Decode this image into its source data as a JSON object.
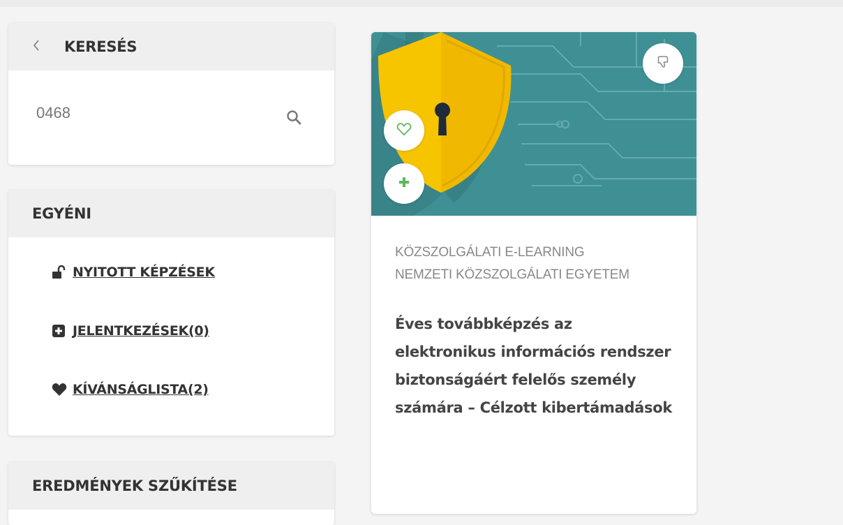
{
  "search_panel": {
    "title": "KERESÉS",
    "search_value": "0468",
    "icons": {
      "back": "chevron-left-icon",
      "search": "search-icon"
    }
  },
  "personal_panel": {
    "title": "EGYÉNI",
    "links": [
      {
        "label": "NYITOTT KÉPZÉSEK",
        "icon": "unlock-icon"
      },
      {
        "label": "JELENTKEZÉSEK(0)",
        "icon": "plus-square-icon"
      },
      {
        "label": "KÍVÁNSÁGLISTA(2)",
        "icon": "heart-icon"
      }
    ]
  },
  "filter_panel": {
    "title": "EREDMÉNYEK SZŰKÍTÉSE"
  },
  "course_card": {
    "category": "KÖZSZOLGÁLATI E-LEARNING",
    "provider": "NEMZETI KÖZSZOLGÁLATI EGYETEM",
    "title": "Éves továbbképzés az elektronikus információs rendszer biztonságáért felelős személy számára – Célzott kibertámadások",
    "image_icon": "shield-keyhole-icon",
    "buttons": {
      "dislike": "thumbs-down-icon",
      "wishlist": "heart-outline-icon",
      "enroll": "plus-icon"
    }
  },
  "colors": {
    "card_image_bg": "#3f9094",
    "shield": "#f7c400",
    "accent_green": "#5cb85c",
    "panel_header_bg": "#efefef"
  }
}
